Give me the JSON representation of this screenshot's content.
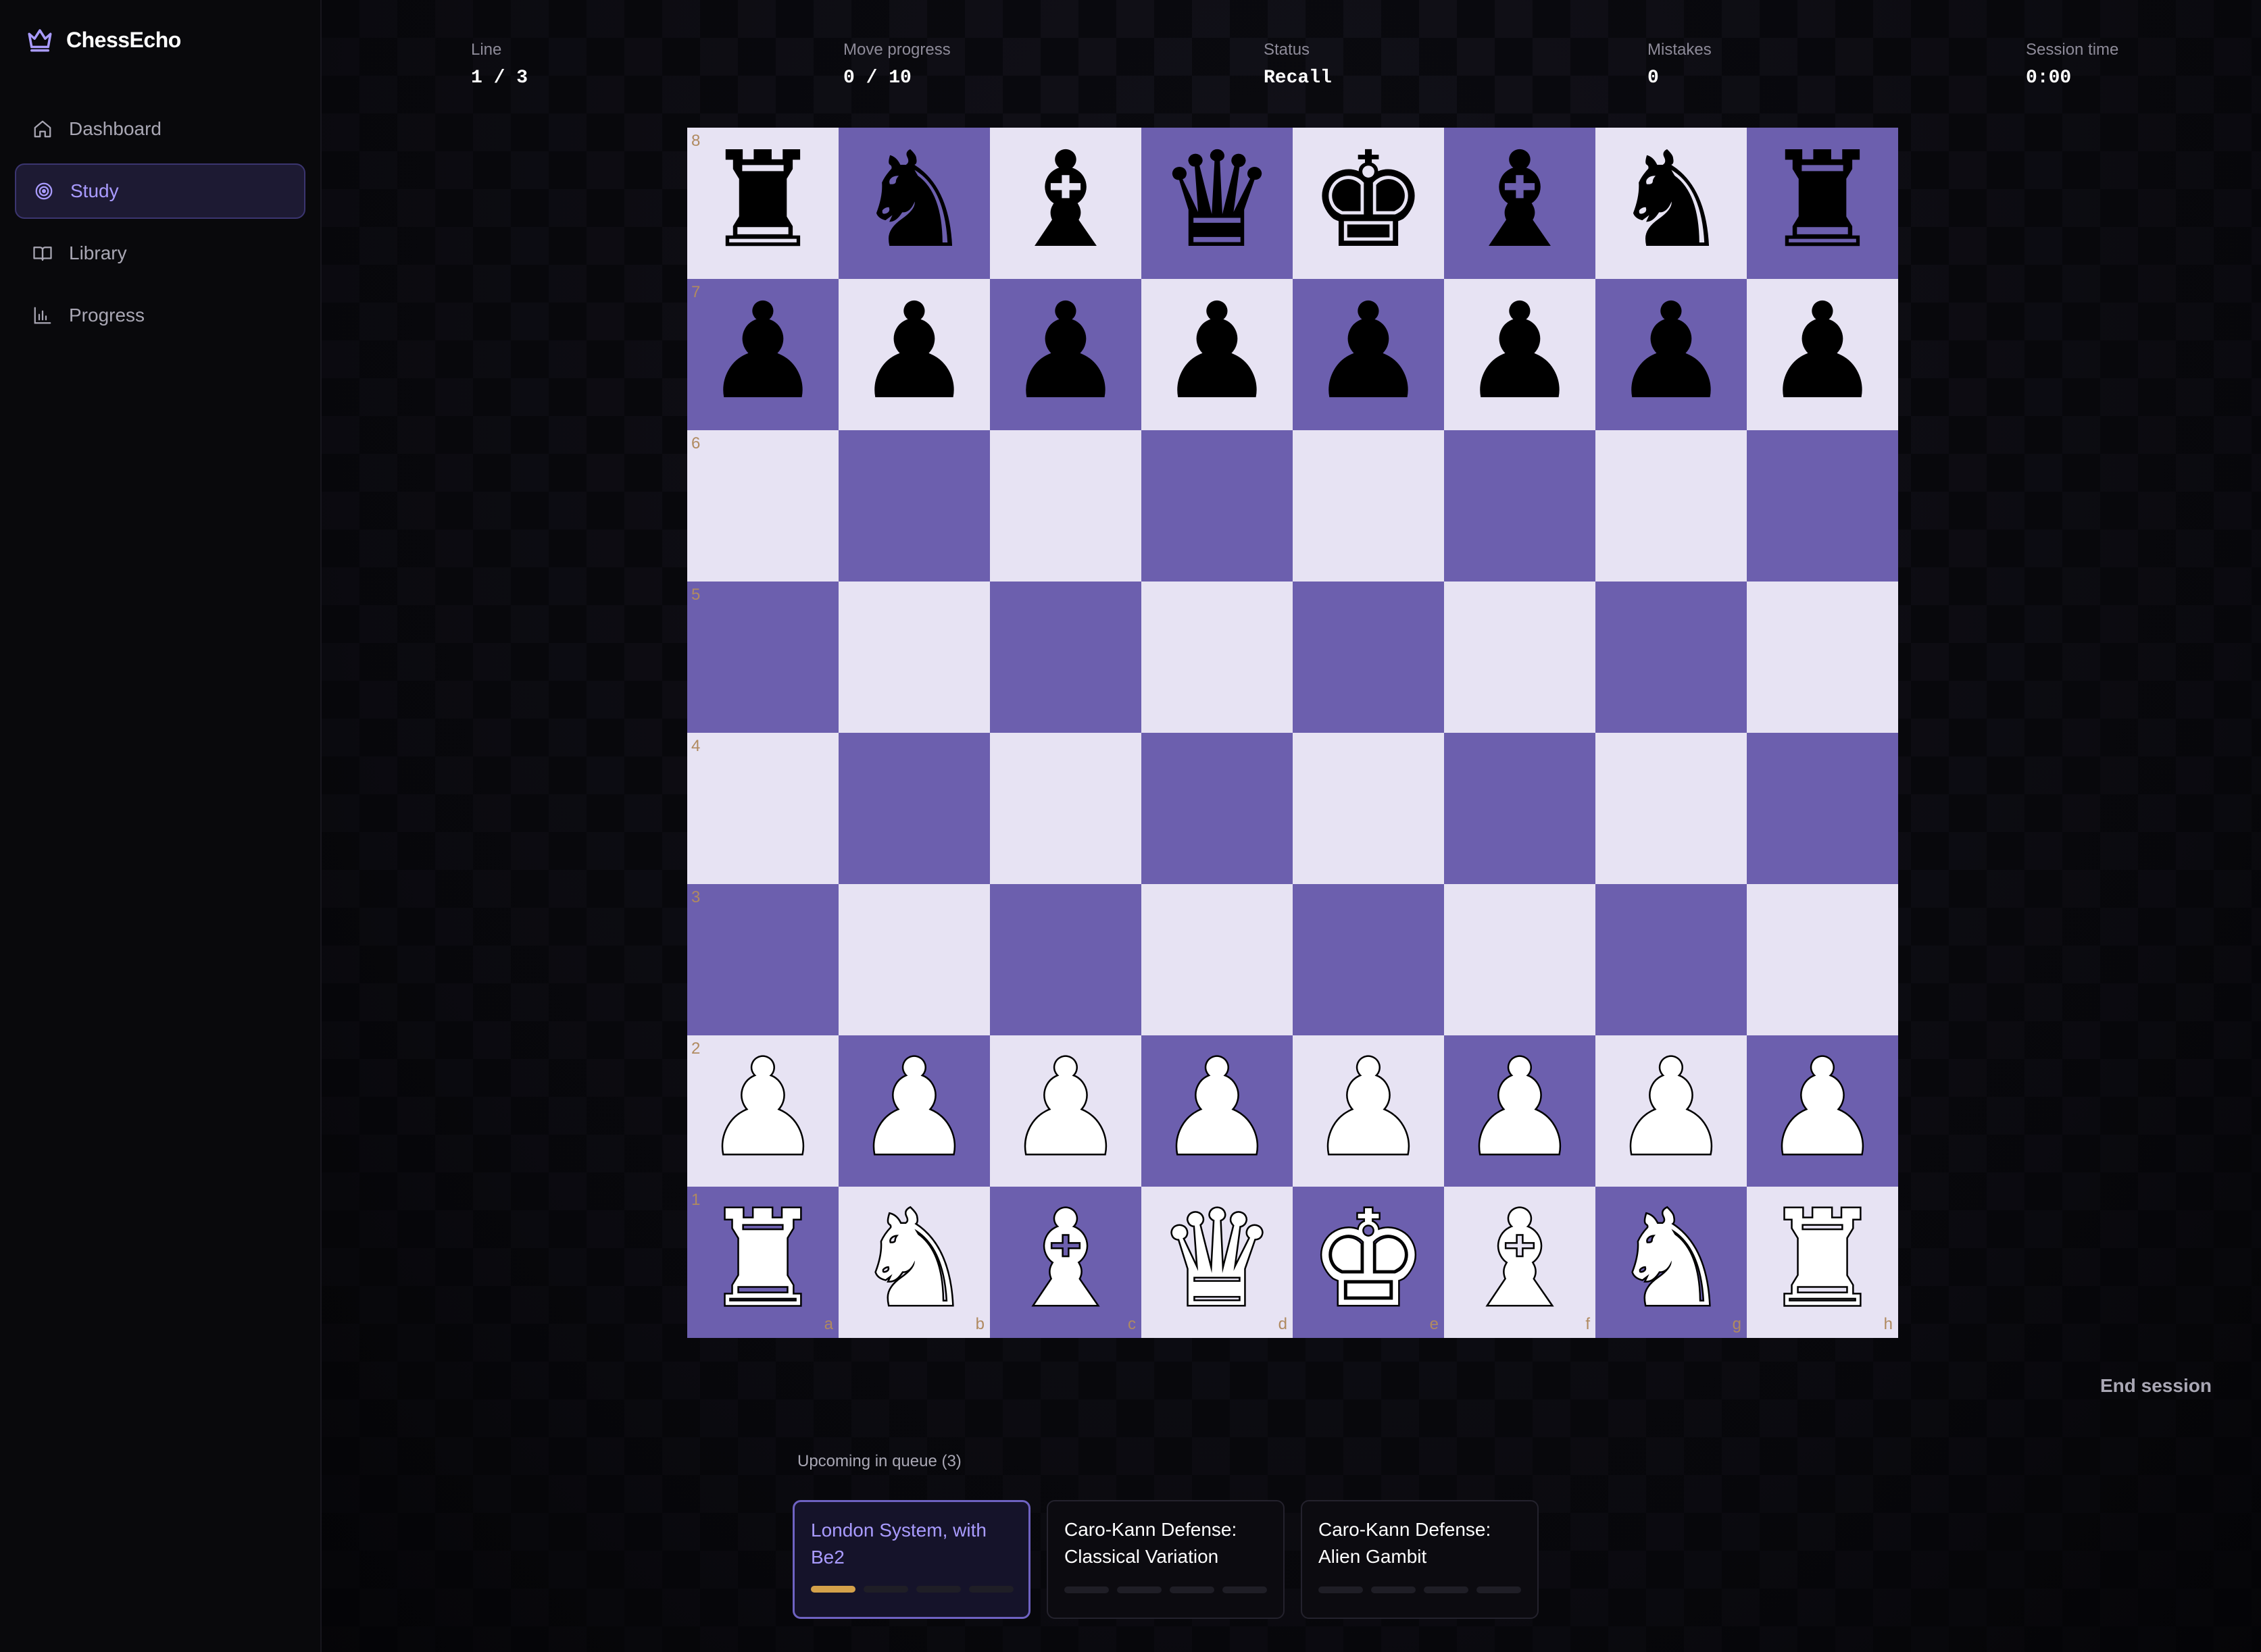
{
  "app": {
    "name": "ChessEcho",
    "icon": "crown-icon",
    "accent": "#a99bff"
  },
  "sidebar": {
    "items": [
      {
        "label": "Dashboard",
        "icon": "home-icon",
        "active": false
      },
      {
        "label": "Study",
        "icon": "target-icon",
        "active": true
      },
      {
        "label": "Library",
        "icon": "book-icon",
        "active": false
      },
      {
        "label": "Progress",
        "icon": "bar-chart-icon",
        "active": false
      }
    ]
  },
  "stats": [
    {
      "label": "Line",
      "value": "1 / 3"
    },
    {
      "label": "Move progress",
      "value": "0 / 10"
    },
    {
      "label": "Status",
      "value": "Recall"
    },
    {
      "label": "Mistakes",
      "value": "0"
    },
    {
      "label": "Session time",
      "value": "0:00"
    }
  ],
  "board": {
    "colors": {
      "light": "#e7e3f3",
      "dark": "#6c5fae",
      "coord": "#b08a60"
    },
    "ranks": [
      "8",
      "7",
      "6",
      "5",
      "4",
      "3",
      "2",
      "1"
    ],
    "files": [
      "a",
      "b",
      "c",
      "d",
      "e",
      "f",
      "g",
      "h"
    ],
    "position": [
      [
        "br",
        "bn",
        "bb",
        "bq",
        "bk",
        "bb",
        "bn",
        "br"
      ],
      [
        "bp",
        "bp",
        "bp",
        "bp",
        "bp",
        "bp",
        "bp",
        "bp"
      ],
      [
        "",
        "",
        "",
        "",
        "",
        "",
        "",
        ""
      ],
      [
        "",
        "",
        "",
        "",
        "",
        "",
        "",
        ""
      ],
      [
        "",
        "",
        "",
        "",
        "",
        "",
        "",
        ""
      ],
      [
        "",
        "",
        "",
        "",
        "",
        "",
        "",
        ""
      ],
      [
        "wp",
        "wp",
        "wp",
        "wp",
        "wp",
        "wp",
        "wp",
        "wp"
      ],
      [
        "wr",
        "wn",
        "wb",
        "wq",
        "wk",
        "wb",
        "wn",
        "wr"
      ]
    ]
  },
  "actions": {
    "end_session": "End session"
  },
  "queue": {
    "label": "Upcoming in queue (3)",
    "items": [
      {
        "title": "London System, with Be2",
        "active": true,
        "progress": 1,
        "total": 4
      },
      {
        "title": "Caro-Kann Defense: Classical Variation",
        "active": false,
        "progress": 0,
        "total": 4
      },
      {
        "title": "Caro-Kann Defense: Alien Gambit",
        "active": false,
        "progress": 0,
        "total": 4
      }
    ],
    "progress_color": "#d4a14a"
  }
}
